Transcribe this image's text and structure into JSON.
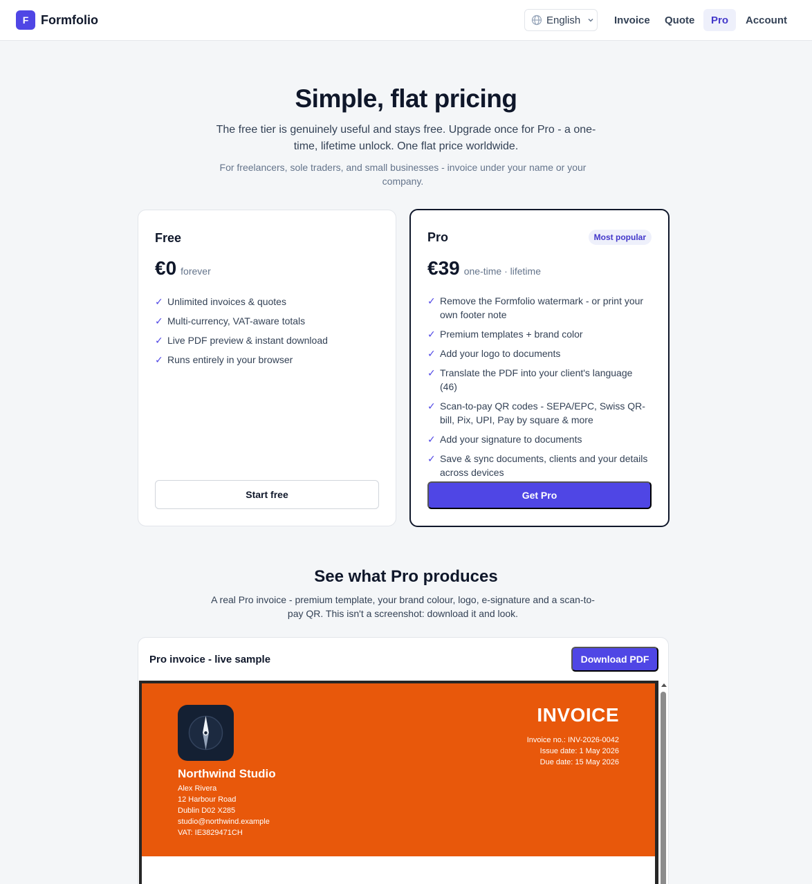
{
  "header": {
    "brand_letter": "F",
    "brand_name": "Formfolio",
    "language": "English",
    "nav": [
      {
        "label": "Invoice",
        "active": false
      },
      {
        "label": "Quote",
        "active": false
      },
      {
        "label": "Pro",
        "active": true
      },
      {
        "label": "Account",
        "active": false
      }
    ]
  },
  "hero": {
    "title": "Simple, flat pricing",
    "subtitle": "The free tier is genuinely useful and stays free. Upgrade once for Pro - a one-time, lifetime unlock. One flat price worldwide.",
    "note": "For freelancers, sole traders, and small businesses - invoice under your name or your company."
  },
  "plans": {
    "free": {
      "name": "Free",
      "price": "€0",
      "period": "forever",
      "features": [
        "Unlimited invoices & quotes",
        "Multi-currency, VAT-aware totals",
        "Live PDF preview & instant download",
        "Runs entirely in your browser"
      ],
      "cta": "Start free"
    },
    "pro": {
      "name": "Pro",
      "badge": "Most popular",
      "price": "€39",
      "period": "one-time · lifetime",
      "features": [
        "Remove the Formfolio watermark - or print your own footer note",
        "Premium templates + brand color",
        "Add your logo to documents",
        "Translate the PDF into your client's language (46)",
        "Scan-to-pay QR codes - SEPA/EPC, Swiss QR-bill, Pix, UPI, Pay by square & more",
        "Add your signature to documents",
        "Save & sync documents, clients and your details across devices"
      ],
      "cta": "Get Pro"
    },
    "check_glyph": "✓"
  },
  "showcase": {
    "title": "See what Pro produces",
    "subtitle": "A real Pro invoice - premium template, your brand colour, logo, e-signature and a scan-to-pay QR. This isn't a screenshot: download it and look.",
    "panel_title": "Pro invoice - live sample",
    "download_label": "Download PDF",
    "invoice": {
      "accent_color": "#e8580b",
      "logo_icon": "compass-icon",
      "company": "Northwind Studio",
      "address_lines": [
        "Alex Rivera",
        "12 Harbour Road",
        "Dublin D02 X285",
        "studio@northwind.example",
        "VAT: IE3829471CH"
      ],
      "doc_title": "INVOICE",
      "meta_lines": [
        "Invoice no.: INV-2026-0042",
        "Issue date: 1 May 2026",
        "Due date: 15 May 2026"
      ]
    }
  },
  "colors": {
    "brand": "#4f46e5",
    "page_bg": "#f4f6f8",
    "ink": "#0f172a"
  }
}
